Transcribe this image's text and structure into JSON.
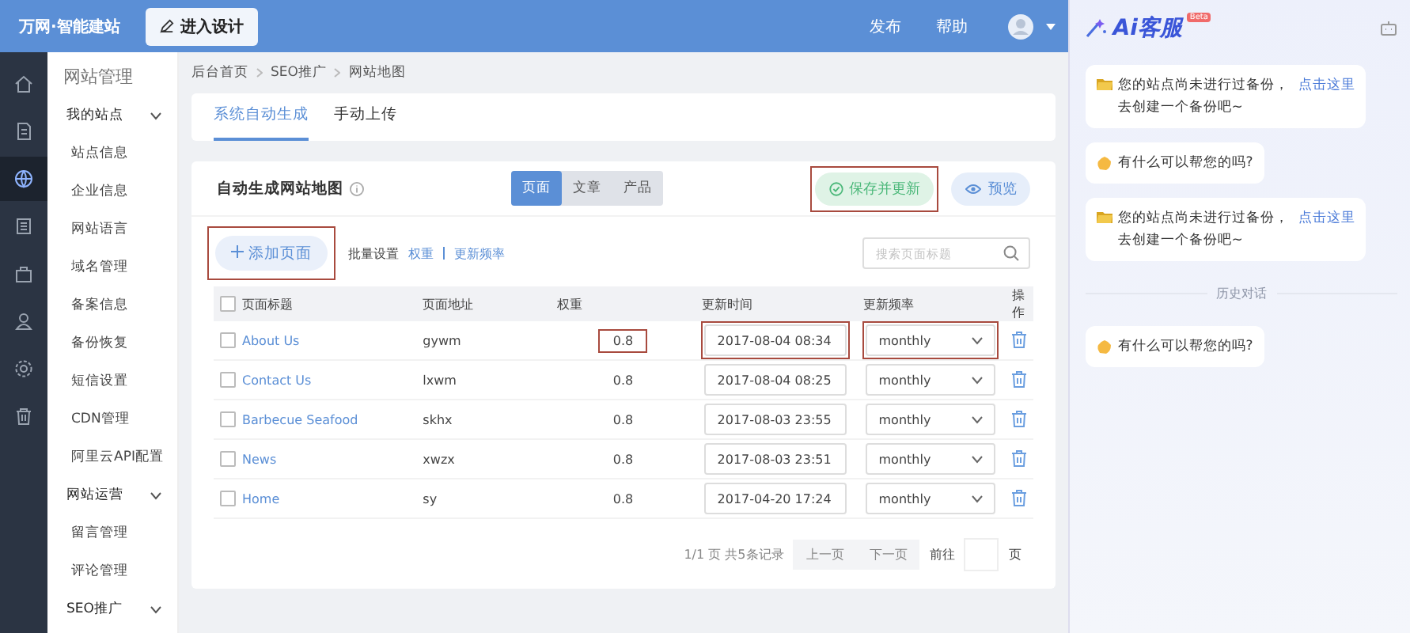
{
  "topbar": {
    "logo": "万网·智能建站",
    "design_button": "进入设计",
    "links": [
      "发布",
      "帮助"
    ]
  },
  "rail": [
    {
      "kind": "home",
      "selected": false
    },
    {
      "kind": "doc",
      "selected": false
    },
    {
      "kind": "globe",
      "selected": true
    },
    {
      "kind": "list",
      "selected": false
    },
    {
      "kind": "bag",
      "selected": false
    },
    {
      "kind": "user",
      "selected": false
    },
    {
      "kind": "gear",
      "selected": false
    },
    {
      "kind": "trash",
      "selected": false
    }
  ],
  "sidebar": {
    "title": "网站管理",
    "groups": [
      {
        "label": "我的站点",
        "expanded": true,
        "children": [
          {
            "label": "站点信息"
          },
          {
            "label": "企业信息"
          },
          {
            "label": "网站语言"
          },
          {
            "label": "域名管理"
          },
          {
            "label": "备案信息"
          },
          {
            "label": "备份恢复"
          },
          {
            "label": "短信设置"
          },
          {
            "label": "CDN管理"
          },
          {
            "label": "阿里云API配置"
          }
        ]
      },
      {
        "label": "网站运营",
        "expanded": true,
        "children": [
          {
            "label": "留言管理"
          },
          {
            "label": "评论管理"
          }
        ]
      },
      {
        "label": "SEO推广",
        "expanded": true
      }
    ]
  },
  "breadcrumb": [
    "后台首页",
    "SEO推广",
    "网站地图"
  ],
  "tabs": [
    {
      "label": "系统自动生成",
      "selected": true
    },
    {
      "label": "手动上传",
      "selected": false
    }
  ],
  "card": {
    "title": "自动生成网站地图",
    "segments": [
      {
        "label": "页面",
        "selected": true
      },
      {
        "label": "文章",
        "selected": false
      },
      {
        "label": "产品",
        "selected": false
      }
    ],
    "save_button": {
      "label": "保存并更新",
      "highlighted": true
    },
    "preview_button": "预览",
    "add_button": {
      "label": "添加页面",
      "highlighted": true
    },
    "batch_label": "批量设置",
    "batch_links": [
      "权重",
      "更新频率"
    ],
    "search": {
      "placeholder": "搜索页面标题"
    }
  },
  "table": {
    "select_all_checked": false,
    "columns": [
      "页面标题",
      "页面地址",
      "权重",
      "更新时间",
      "更新频率",
      "操作"
    ],
    "rows": [
      {
        "title": "About Us",
        "path": "gywm",
        "weight": "0.8",
        "time": "2017-08-04 08:34",
        "freq": "monthly",
        "checked": false,
        "highlighted": true
      },
      {
        "title": "Contact Us",
        "path": "lxwm",
        "weight": "0.8",
        "time": "2017-08-04 08:25",
        "freq": "monthly",
        "checked": false,
        "highlighted": false
      },
      {
        "title": "Barbecue Seafood",
        "path": "skhx",
        "weight": "0.8",
        "time": "2017-08-03 23:55",
        "freq": "monthly",
        "checked": false,
        "highlighted": false
      },
      {
        "title": "News",
        "path": "xwzx",
        "weight": "0.8",
        "time": "2017-08-03 23:51",
        "freq": "monthly",
        "checked": false,
        "highlighted": false
      },
      {
        "title": "Home",
        "path": "sy",
        "weight": "0.8",
        "time": "2017-04-20 17:24",
        "freq": "monthly",
        "checked": false,
        "highlighted": false
      }
    ]
  },
  "pagination": {
    "summary": "1/1 页 共5条记录",
    "prev": "上一页",
    "next": "下一页",
    "goto": "前往",
    "unit": "页"
  },
  "assistant": {
    "title": "Ai客服",
    "badge": "Beta",
    "messages": [
      {
        "kind": "notice",
        "text": "您的站点尚未进行过备份，",
        "link": "点击这里",
        "tail": "去创建一个备份吧~"
      },
      {
        "kind": "greeting",
        "text": "有什么可以帮您的吗?"
      },
      {
        "kind": "notice",
        "text": "您的站点尚未进行过备份，",
        "link": "点击这里",
        "tail": "去创建一个备份吧~"
      },
      {
        "kind": "divider",
        "text": "历史对话"
      },
      {
        "kind": "greeting",
        "text": "有什么可以帮您的吗?"
      }
    ]
  }
}
